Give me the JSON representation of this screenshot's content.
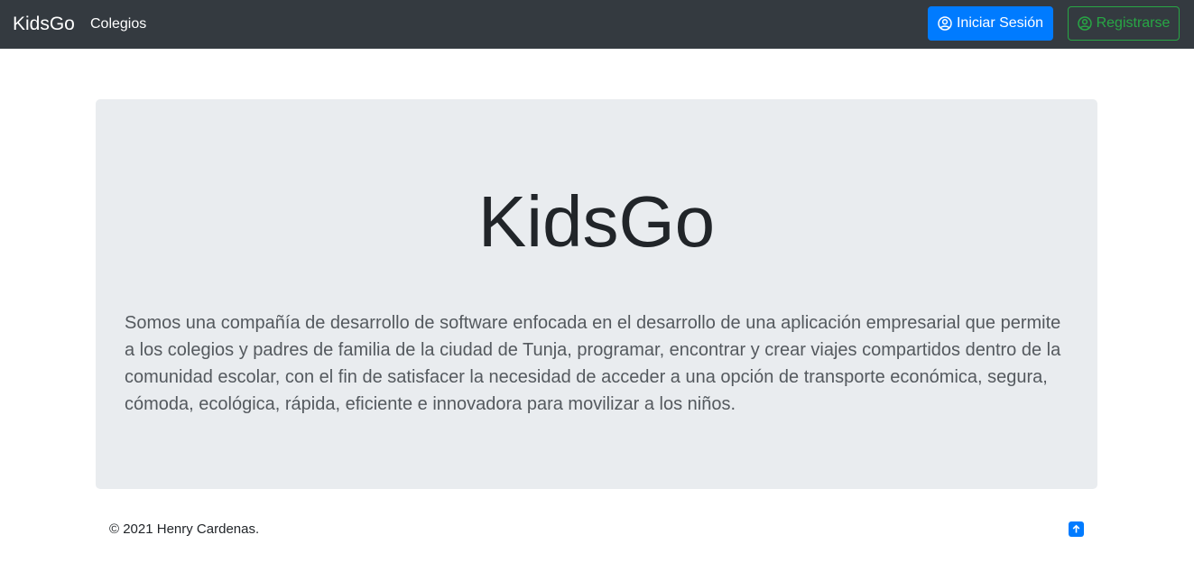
{
  "navbar": {
    "brand": "KidsGo",
    "links": [
      {
        "label": "Colegios"
      }
    ],
    "login_button": {
      "label": "Iniciar Sesión",
      "icon": "user-circle-icon",
      "color": "#007bff"
    },
    "register_button": {
      "label": "Registrarse",
      "icon": "user-circle-icon",
      "color": "#28a745"
    },
    "background": "#343a40"
  },
  "hero": {
    "title": "KidsGo",
    "description": "Somos una compañía de desarrollo de software enfocada en el desarrollo de una aplicación empresarial que permite a los colegios y padres de familia de la ciudad de Tunja, programar, encontrar y crear viajes compartidos dentro de la comunidad escolar, con el fin de satisfacer la necesidad de acceder a una opción de transporte económica, segura, cómoda, ecológica, rápida, eficiente e innovadora para movilizar a los niños.",
    "background": "#e9ecef"
  },
  "footer": {
    "copyright": "© 2021 Henry Cardenas.",
    "back_to_top_icon": "arrow-up-icon"
  }
}
